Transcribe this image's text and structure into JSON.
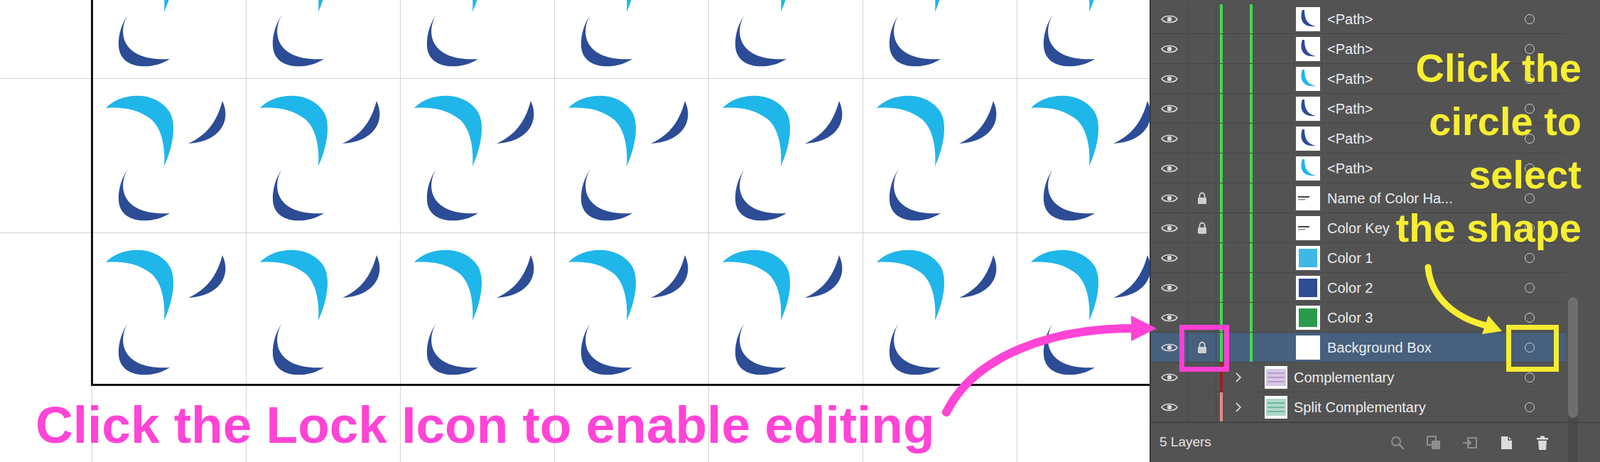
{
  "layers_panel": {
    "rows": [
      {
        "name": "<Path>",
        "kind": "item",
        "visible": true,
        "locked": false,
        "selected": false,
        "layer_color": "#43d84e",
        "thumb": "path",
        "swatch": "#2c4c96"
      },
      {
        "name": "<Path>",
        "kind": "item",
        "visible": true,
        "locked": false,
        "selected": false,
        "layer_color": "#43d84e",
        "thumb": "path",
        "swatch": "#2c4c96"
      },
      {
        "name": "<Path>",
        "kind": "item",
        "visible": true,
        "locked": false,
        "selected": false,
        "layer_color": "#43d84e",
        "thumb": "path",
        "swatch": "#1fb6ea"
      },
      {
        "name": "<Path>",
        "kind": "item",
        "visible": true,
        "locked": false,
        "selected": false,
        "layer_color": "#43d84e",
        "thumb": "path",
        "swatch": "#2c4c96"
      },
      {
        "name": "<Path>",
        "kind": "item",
        "visible": true,
        "locked": false,
        "selected": false,
        "layer_color": "#43d84e",
        "thumb": "path",
        "swatch": "#2c4c96"
      },
      {
        "name": "<Path>",
        "kind": "item",
        "visible": true,
        "locked": false,
        "selected": false,
        "layer_color": "#43d84e",
        "thumb": "path",
        "swatch": "#1fb6ea"
      },
      {
        "name": "Name of Color Ha...",
        "kind": "item",
        "visible": true,
        "locked": true,
        "selected": false,
        "layer_color": "#43d84e",
        "thumb": "text"
      },
      {
        "name": "Color Key",
        "kind": "item",
        "visible": true,
        "locked": true,
        "selected": false,
        "layer_color": "#43d84e",
        "thumb": "text"
      },
      {
        "name": "Color 1",
        "kind": "item",
        "visible": true,
        "locked": false,
        "selected": false,
        "layer_color": "#43d84e",
        "thumb": "swatch",
        "swatch": "#3fb8e8"
      },
      {
        "name": "Color 2",
        "kind": "item",
        "visible": true,
        "locked": false,
        "selected": false,
        "layer_color": "#43d84e",
        "thumb": "swatch",
        "swatch": "#2f4b94"
      },
      {
        "name": "Color 3",
        "kind": "item",
        "visible": true,
        "locked": false,
        "selected": false,
        "layer_color": "#43d84e",
        "thumb": "swatch",
        "swatch": "#2a9a4a"
      },
      {
        "name": "Background Box",
        "kind": "item",
        "visible": true,
        "locked": true,
        "selected": true,
        "layer_color": "#43d84e",
        "thumb": "box"
      },
      {
        "name": "Complementary",
        "kind": "layer",
        "visible": true,
        "locked": false,
        "selected": false,
        "expanded": false,
        "layer_color": "#9a1f1f",
        "thumb": "group",
        "swatch": "#b79bcf"
      },
      {
        "name": "Split Complementary",
        "kind": "layer",
        "visible": true,
        "locked": false,
        "selected": false,
        "expanded": false,
        "layer_color": "#e88a8a",
        "thumb": "group",
        "swatch": "#6fb8a0"
      }
    ],
    "scrollbar": {
      "level": 1
    },
    "footer": {
      "count": "5 Layers",
      "tools": [
        {
          "kind": "search",
          "disabled": true
        },
        {
          "kind": "clip",
          "disabled": true
        },
        {
          "kind": "move",
          "disabled": true
        },
        {
          "kind": "new",
          "disabled": false
        },
        {
          "kind": "delete",
          "disabled": false
        }
      ]
    }
  },
  "annotations": {
    "target_hint": {
      "lines": [
        "Click the",
        "circle to",
        "select",
        "the shape"
      ]
    },
    "lock_hint": {
      "text": "Click the Lock Icon to enable editing"
    }
  }
}
